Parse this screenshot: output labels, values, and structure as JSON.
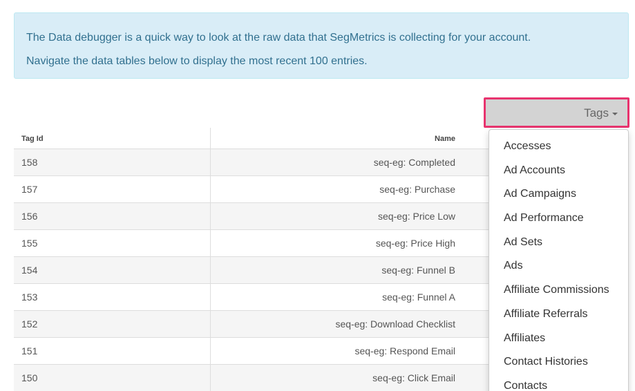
{
  "banner": {
    "line1": "The Data debugger is a quick way to look at the raw data that SegMetrics is collecting for your account.",
    "line2": "Navigate the data tables below to display the most recent 100 entries."
  },
  "tables_dropdown": {
    "label": "Tags",
    "items": [
      "Accesses",
      "Ad Accounts",
      "Ad Campaigns",
      "Ad Performance",
      "Ad Sets",
      "Ads",
      "Affiliate Commissions",
      "Affiliate Referrals",
      "Affiliates",
      "Contact Histories",
      "Contacts"
    ]
  },
  "table": {
    "headers": {
      "id": "Tag Id",
      "name": "Name"
    },
    "rows": [
      {
        "id": "158",
        "name": "seq-eg: Completed"
      },
      {
        "id": "157",
        "name": "seq-eg: Purchase"
      },
      {
        "id": "156",
        "name": "seq-eg: Price Low"
      },
      {
        "id": "155",
        "name": "seq-eg: Price High"
      },
      {
        "id": "154",
        "name": "seq-eg: Funnel B"
      },
      {
        "id": "153",
        "name": "seq-eg: Funnel A"
      },
      {
        "id": "152",
        "name": "seq-eg: Download Checklist"
      },
      {
        "id": "151",
        "name": "seq-eg: Respond Email"
      },
      {
        "id": "150",
        "name": "seq-eg: Click Email"
      }
    ]
  },
  "colors": {
    "banner_bg": "#d9edf7",
    "banner_text": "#31708f",
    "highlight_border": "#e8336e",
    "dropdown_button_bg": "#d3d3d3",
    "row_stripe": "#f5f5f5"
  }
}
